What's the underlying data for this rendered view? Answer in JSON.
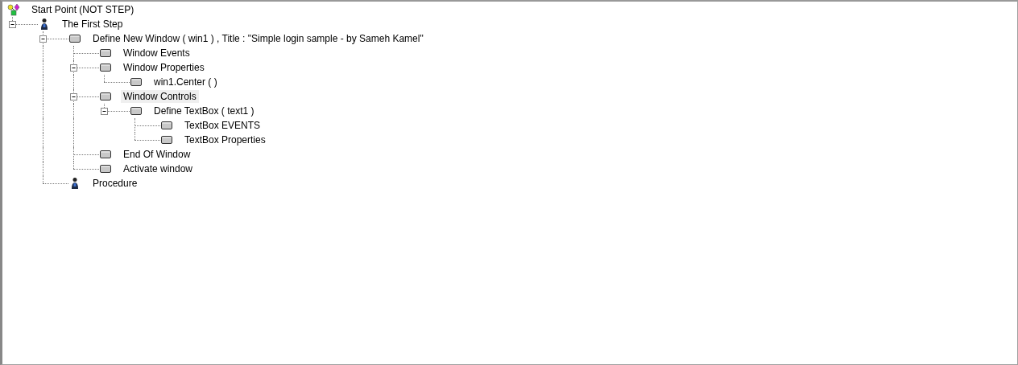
{
  "tree": [
    {
      "label": "Start Point (NOT STEP)",
      "kind": "start",
      "selected": false,
      "children": [
        {
          "label": "The First Step",
          "kind": "step",
          "selected": false,
          "expanded": true,
          "children": [
            {
              "label": "Define New Window  ( win1 ) , Title : \"Simple login sample - by Sameh Kamel\"",
              "kind": "block",
              "selected": false,
              "expanded": true,
              "children": [
                {
                  "label": "Window Events",
                  "kind": "block",
                  "selected": false
                },
                {
                  "label": "Window Properties",
                  "kind": "block",
                  "selected": false,
                  "expanded": true,
                  "children": [
                    {
                      "label": "win1.Center ( )",
                      "kind": "block",
                      "selected": false
                    }
                  ]
                },
                {
                  "label": "Window Controls",
                  "kind": "block",
                  "selected": true,
                  "expanded": true,
                  "children": [
                    {
                      "label": "Define TextBox  ( text1  )",
                      "kind": "block",
                      "selected": false,
                      "expanded": true,
                      "children": [
                        {
                          "label": "TextBox EVENTS",
                          "kind": "block",
                          "selected": false
                        },
                        {
                          "label": "TextBox Properties",
                          "kind": "block",
                          "selected": false
                        }
                      ]
                    }
                  ]
                },
                {
                  "label": "End Of Window",
                  "kind": "block",
                  "selected": false
                },
                {
                  "label": "Activate window",
                  "kind": "block",
                  "selected": false
                }
              ]
            },
            {
              "label": "Procedure",
              "kind": "step",
              "selected": false
            }
          ]
        }
      ]
    }
  ]
}
